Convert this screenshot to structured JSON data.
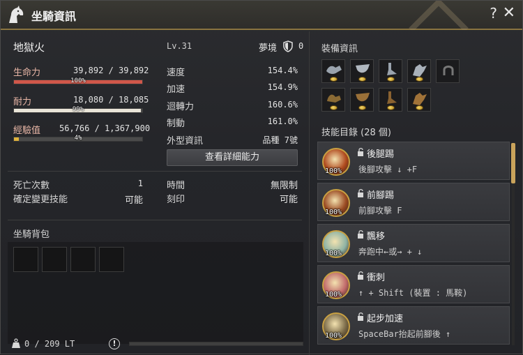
{
  "window": {
    "title": "坐騎資訊",
    "help": "?",
    "close": "✕"
  },
  "mount": {
    "name": "地獄火",
    "level": "Lv.31",
    "dream_label": "夢境",
    "dream_value": "0"
  },
  "bars": {
    "hp": {
      "label": "生命力",
      "value": "39,892 / 39,892",
      "pct_text": "100%",
      "fraction": 1.0,
      "color": "#d0574a"
    },
    "stamina": {
      "label": "耐力",
      "value": "18,080 / 18,085",
      "pct_text": "99%",
      "fraction": 0.99,
      "color": "#e9e4d8"
    },
    "exp": {
      "label": "經驗值",
      "value": "56,766 / 1,367,900",
      "pct_text": "4%",
      "fraction": 0.04,
      "color": "#e0b23c"
    }
  },
  "stats": [
    {
      "label": "速度",
      "value": "154.4%"
    },
    {
      "label": "加速",
      "value": "154.9%"
    },
    {
      "label": "迴轉力",
      "value": "160.6%"
    },
    {
      "label": "制動",
      "value": "161.0%"
    },
    {
      "label": "外型資訊",
      "value": "品種 7號"
    }
  ],
  "detail_button": "查看詳細能力",
  "misc": {
    "deaths_label": "死亡次數",
    "deaths_value": "1",
    "skill_change_label": "確定變更技能",
    "skill_change_value": "可能",
    "time_label": "時間",
    "time_value": "無限制",
    "imprint_label": "刻印",
    "imprint_value": "可能"
  },
  "bag": {
    "title": "坐騎背包",
    "weight": "0 / 209 LT",
    "warn_icon": "!"
  },
  "equipment": {
    "title": "裝備資訊",
    "slots": [
      "saddle-icon",
      "stirrup-icon",
      "horseshoe-icon",
      "armor-icon",
      "horseshoe-empty-icon",
      "saddle2-icon",
      "stirrup2-icon",
      "horseshoe2-icon",
      "armor2-icon"
    ]
  },
  "skills": {
    "title": "技能目錄 (28 個)",
    "items": [
      {
        "name": "後腿踢",
        "desc": "後腳攻擊 ↓ +F",
        "pct": "100%",
        "icon_color": "#b04a1e"
      },
      {
        "name": "前腳踢",
        "desc": "前腳攻擊 F",
        "pct": "100%",
        "icon_color": "#9a4a22"
      },
      {
        "name": "飄移",
        "desc": "奔跑中←或→ + ↓",
        "pct": "100%",
        "icon_color": "#8fb3a4"
      },
      {
        "name": "衝刺",
        "desc": "↑ + Shift (裝置 : 馬鞍)",
        "pct": "100%",
        "icon_color": "#c06a6a"
      },
      {
        "name": "起步加速",
        "desc": "SpaceBar抬起前腳後 ↑",
        "pct": "100%",
        "icon_color": "#7a6a48"
      }
    ]
  }
}
